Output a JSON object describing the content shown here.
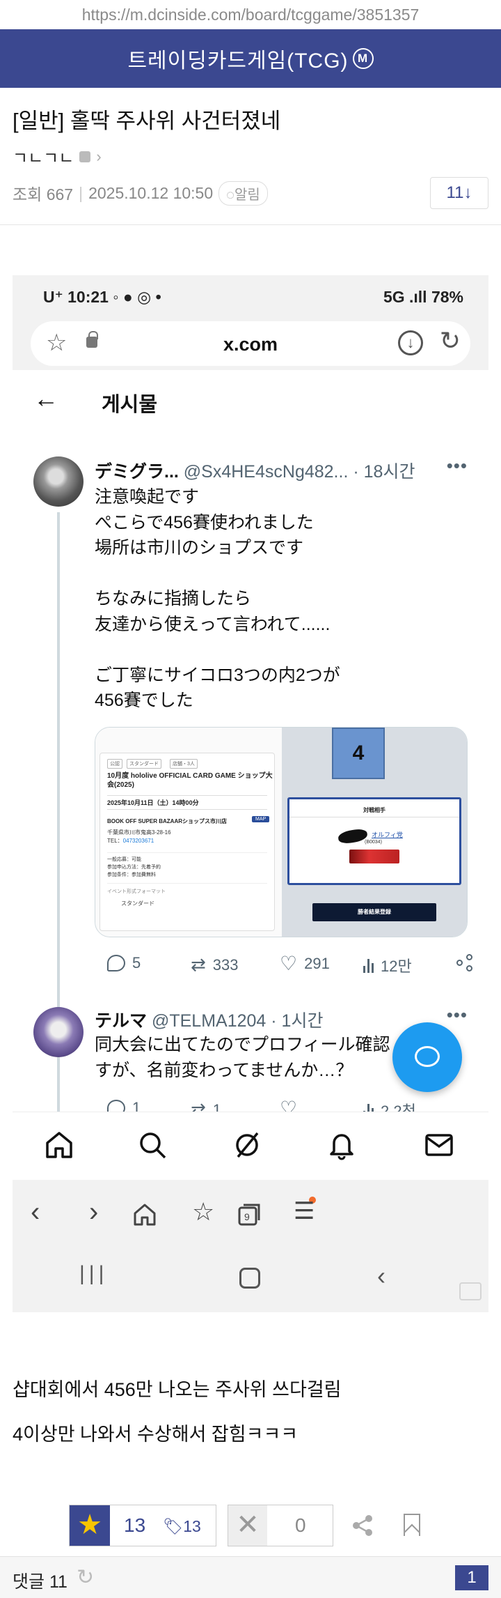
{
  "browser": {
    "url": "https://m.dcinside.com/board/tcggame/3851357"
  },
  "gallery": {
    "name": "트레이딩카드게임(TCG)",
    "badge": "M"
  },
  "post": {
    "title": "[일반] 홀딱 주사위 사건터졌네",
    "author": "ㄱㄴㄱㄴ",
    "views_label": "조회 667",
    "datetime": "2025.10.12 10:50",
    "alarm": "알림",
    "comment_count_btn": "11↓"
  },
  "screenshot": {
    "status_left": "U⁺ 10:21",
    "status_right": "5G .ıll 78%",
    "url": "x.com",
    "header_title": "게시물",
    "tweets": [
      {
        "name": "デミグラ...",
        "handle": "@Sx4HE4scNg482...",
        "time": "· 18시간",
        "lines": [
          "注意喚起です",
          "ぺこらで456賽使われました",
          "場所は市川のショプスです",
          "",
          "ちなみに指摘したら",
          "友達から使えって言われて......",
          "",
          "ご丁寧にサイコロ3つの内2つが",
          "456賽でした"
        ],
        "replies": "5",
        "retweets": "333",
        "likes": "291",
        "views": "12만"
      },
      {
        "name": "テルマ",
        "handle": "@TELMA1204",
        "time": "· 1시간",
        "lines": [
          "同大会に出てたのでプロフィール確認",
          "すが、名前変わってませんか…？"
        ],
        "replies": "1",
        "retweets": "1",
        "likes": "",
        "views": "2.2천"
      }
    ],
    "media": {
      "tags": [
        "公認",
        "スタンダード",
        "店舗・3人"
      ],
      "event_title": "10月度 hololive OFFICIAL CARD GAME ショップ大会(2025)",
      "event_date": "2025年10月11日（土）14時00分",
      "shop": "BOOK OFF SUPER BAZAARショップス市川店",
      "map_btn": "MAP",
      "address": "千葉県市川市鬼高3-28-16",
      "tel_label": "TEL：",
      "tel": "0473203671",
      "conditions": [
        "一般応募：可能",
        "参加申込方法：先着予約",
        "参加条件：参加費無料"
      ],
      "format_label": "イベント形式フォーマット",
      "format": "スタンダード",
      "die_value": "4",
      "opponent_title": "対戦相手",
      "opponent_name": "オルフィ党",
      "opponent_id": "(B0034)",
      "submit": "勝者結果登録"
    }
  },
  "body": {
    "line1": "샵대회에서 456만 나오는 주사위 쓰다걸림",
    "line2": "4이상만 나와서 수상해서 잡힘ㅋㅋㅋ"
  },
  "votes": {
    "up": "13",
    "fixed": "13",
    "down": "0"
  },
  "comments": {
    "label": "댓글 11",
    "page": "1"
  }
}
